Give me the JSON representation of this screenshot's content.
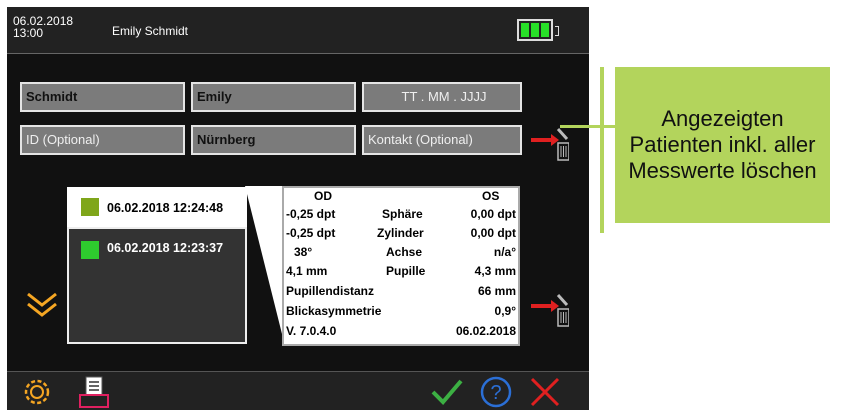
{
  "header": {
    "date": "06.02.2018",
    "time": "13:00",
    "user": "Emily Schmidt",
    "battery_level": 1.0
  },
  "form": {
    "last_name": "Schmidt",
    "first_name": "Emily",
    "birthdate_placeholder": "TT  .  MM  .  JJJJ",
    "id_placeholder": "ID (Optional)",
    "city": "Nürnberg",
    "contact_placeholder": "Kontakt (Optional)"
  },
  "measurements": [
    {
      "timestamp": "06.02.2018 12:24:48",
      "color": "#7fa61a"
    },
    {
      "timestamp": "06.02.2018 12:23:37",
      "color": "#2ecc2e"
    }
  ],
  "results": {
    "header_od": "OD",
    "header_os": "OS",
    "rows": [
      {
        "od": "-0,25 dpt",
        "label": "Sphäre",
        "os": "0,00  dpt"
      },
      {
        "od": "-0,25 dpt",
        "label": "Zylinder",
        "os": "0,00  dpt"
      },
      {
        "od": "38°",
        "label": "Achse",
        "os": "n/a°"
      },
      {
        "od": "4,1    mm",
        "label": "Pupille",
        "os": "4,3  mm"
      }
    ],
    "pd_label": "Pupillendistanz",
    "pd_value": "66  mm",
    "asym_label": "Blickasymmetrie",
    "asym_value": "0,9°",
    "version": "V. 7.0.4.0",
    "version_date": "06.02.2018"
  },
  "callout": {
    "text": "Angezeigten Patienten inkl. aller Messwerte löschen"
  },
  "colors": {
    "accent_orange": "#f5a623",
    "arrow_red": "#e02020",
    "confirm_green": "#3cb043",
    "help_blue": "#2b6fd6",
    "cancel_red": "#e02020",
    "callout_green": "#b3d45c"
  },
  "icons": [
    "settings-icon",
    "report-icon",
    "trash-icon",
    "chevron-down-icon",
    "check-icon",
    "help-icon",
    "close-icon"
  ]
}
